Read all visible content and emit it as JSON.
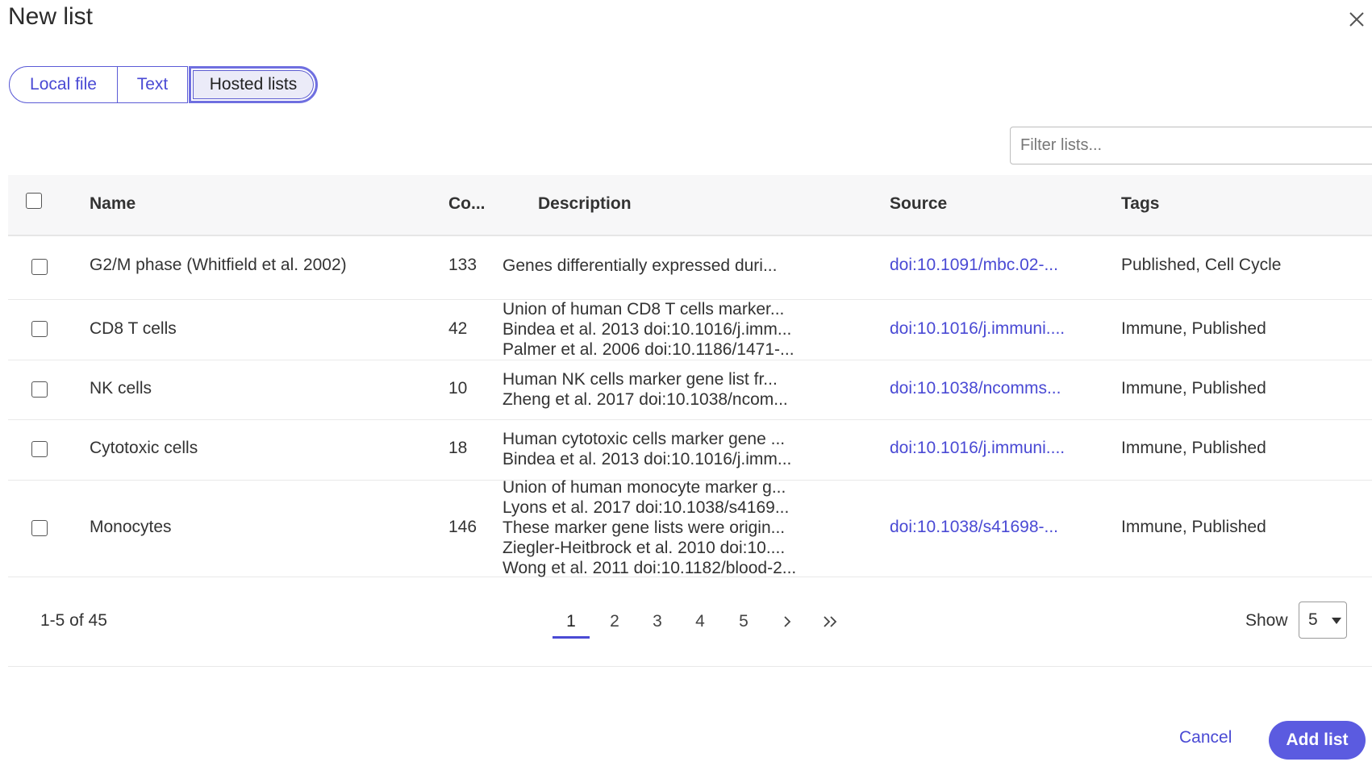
{
  "dialog": {
    "title": "New list",
    "close_icon": "close-icon"
  },
  "tabs": [
    {
      "label": "Local file",
      "selected": false
    },
    {
      "label": "Text",
      "selected": false
    },
    {
      "label": "Hosted lists",
      "selected": true
    }
  ],
  "filter": {
    "placeholder": "Filter lists...",
    "value": ""
  },
  "table": {
    "headers": {
      "name": "Name",
      "count": "Co...",
      "description": "Description",
      "source": "Source",
      "tags": "Tags"
    },
    "rows": [
      {
        "name": "G2/M phase (Whitfield et al. 2002)",
        "count": "133",
        "description": [
          "Genes differentially expressed duri..."
        ],
        "source": "doi:10.1091/mbc.02-...",
        "tags": "Published, Cell Cycle"
      },
      {
        "name": "CD8 T cells",
        "count": "42",
        "description": [
          "Union of human CD8 T cells marker...",
          "Bindea et al. 2013 doi:10.1016/j.imm...",
          "Palmer et al. 2006 doi:10.1186/1471-..."
        ],
        "source": "doi:10.1016/j.immuni....",
        "tags": "Immune, Published"
      },
      {
        "name": "NK cells",
        "count": "10",
        "description": [
          "Human NK cells marker gene list fr...",
          "Zheng et al. 2017 doi:10.1038/ncom..."
        ],
        "source": "doi:10.1038/ncomms...",
        "tags": "Immune, Published"
      },
      {
        "name": "Cytotoxic cells",
        "count": "18",
        "description": [
          "Human cytotoxic cells marker gene ...",
          "Bindea et al. 2013 doi:10.1016/j.imm..."
        ],
        "source": "doi:10.1016/j.immuni....",
        "tags": "Immune, Published"
      },
      {
        "name": "Monocytes",
        "count": "146",
        "description": [
          "Union of human monocyte marker g...",
          "Lyons et al. 2017 doi:10.1038/s4169...",
          "These marker gene lists were origin...",
          "Ziegler-Heitbrock et al. 2010 doi:10....",
          "Wong et al. 2011 doi:10.1182/blood-2..."
        ],
        "source": "doi:10.1038/s41698-...",
        "tags": "Immune, Published"
      }
    ]
  },
  "pagination": {
    "range": "1-5 of 45",
    "pages": [
      "1",
      "2",
      "3",
      "4",
      "5"
    ],
    "current": "1",
    "next_icon": "chevron-right-icon",
    "last_icon": "double-chevron-right-icon",
    "show_label": "Show",
    "page_size": "5"
  },
  "actions": {
    "cancel": "Cancel",
    "add": "Add list"
  },
  "colors": {
    "accent": "#5b5be0",
    "link": "#4a4ad4"
  }
}
